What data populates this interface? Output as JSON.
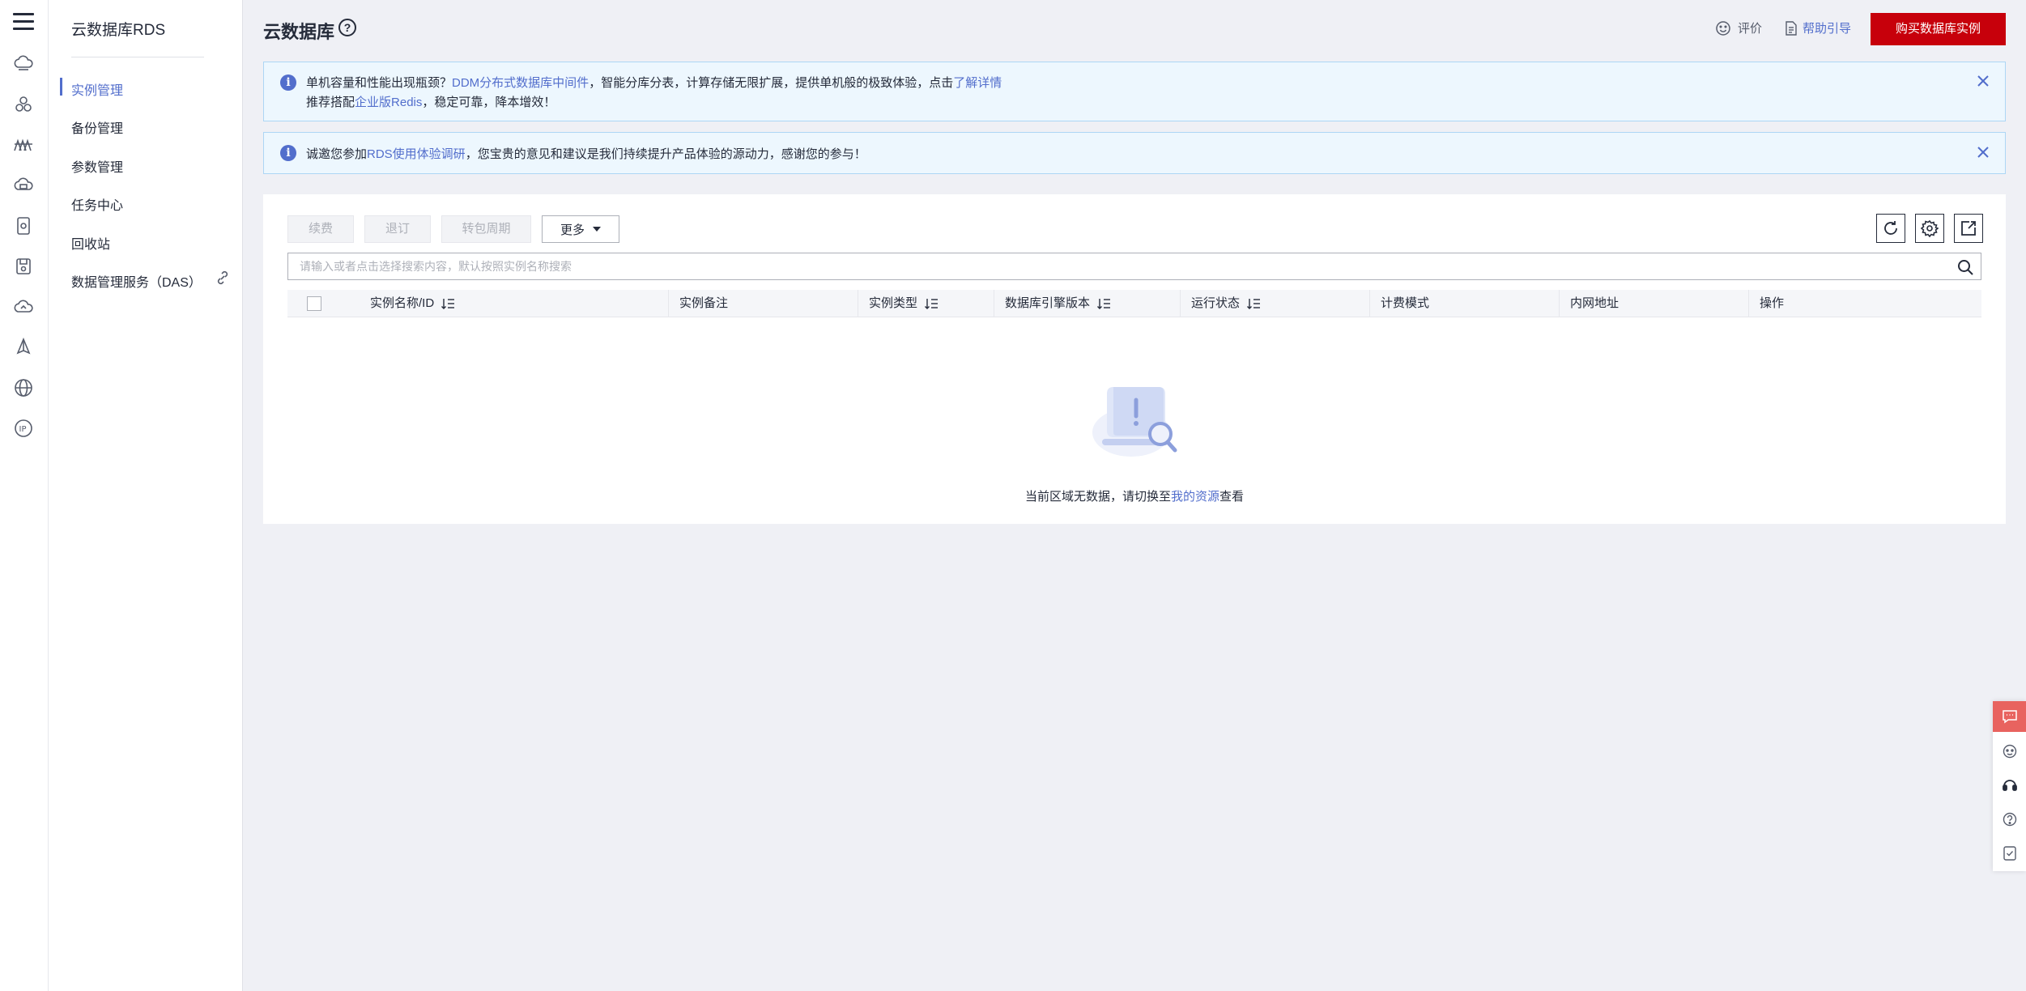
{
  "service": {
    "title": "云数据库RDS"
  },
  "subnav": {
    "items": [
      {
        "label": "实例管理",
        "active": true
      },
      {
        "label": "备份管理",
        "active": false
      },
      {
        "label": "参数管理",
        "active": false
      },
      {
        "label": "任务中心",
        "active": false
      },
      {
        "label": "回收站",
        "active": false
      },
      {
        "label": "数据管理服务（DAS）",
        "active": false
      }
    ]
  },
  "header": {
    "title": "云数据库",
    "rate_label": "评价",
    "guide_label": "帮助引导",
    "buy_label": "购买数据库实例"
  },
  "notice1": {
    "line1_prefix": "单机容量和性能出现瓶颈？",
    "line1_link": "DDM分布式数据库中间件",
    "line1_middle": "，智能分库分表，计算存储无限扩展，提供单机般的极致体验，点击",
    "line1_link2": "了解详情",
    "line2_prefix": "推荐搭配",
    "line2_link": "企业版Redis",
    "line2_suffix": "，稳定可靠，降本增效！"
  },
  "notice2": {
    "prefix": "诚邀您参加",
    "link": "RDS使用体验调研",
    "suffix": "，您宝贵的意见和建议是我们持续提升产品体验的源动力，感谢您的参与！"
  },
  "toolbar": {
    "renew_label": "续费",
    "unsubscribe_label": "退订",
    "to_period_label": "转包周期",
    "more_label": "更多"
  },
  "search": {
    "placeholder": "请输入或者点击选择搜索内容，默认按照实例名称搜索"
  },
  "table": {
    "columns": [
      {
        "label": "实例名称/ID",
        "sortable": true
      },
      {
        "label": "实例备注",
        "sortable": false
      },
      {
        "label": "实例类型",
        "sortable": true
      },
      {
        "label": "数据库引擎版本",
        "sortable": true
      },
      {
        "label": "运行状态",
        "sortable": true
      },
      {
        "label": "计费模式",
        "sortable": false
      },
      {
        "label": "内网地址",
        "sortable": false
      },
      {
        "label": "操作",
        "sortable": false
      }
    ]
  },
  "empty": {
    "prefix": "当前区域无数据，请切换至",
    "link": "我的资源",
    "suffix": "查看"
  },
  "colors": {
    "brand_red": "#c7000b",
    "link_blue": "#526ecc",
    "notice_bg": "#edf7fe",
    "float_accent": "#e8635f"
  },
  "icons": {
    "rail": [
      "cloud-server-icon",
      "cluster-icon",
      "bridge-icon",
      "cloud-db-icon",
      "document-db-icon",
      "storage-icon",
      "cloud-icon",
      "rocket-icon",
      "globe-icon",
      "ip-icon"
    ]
  }
}
